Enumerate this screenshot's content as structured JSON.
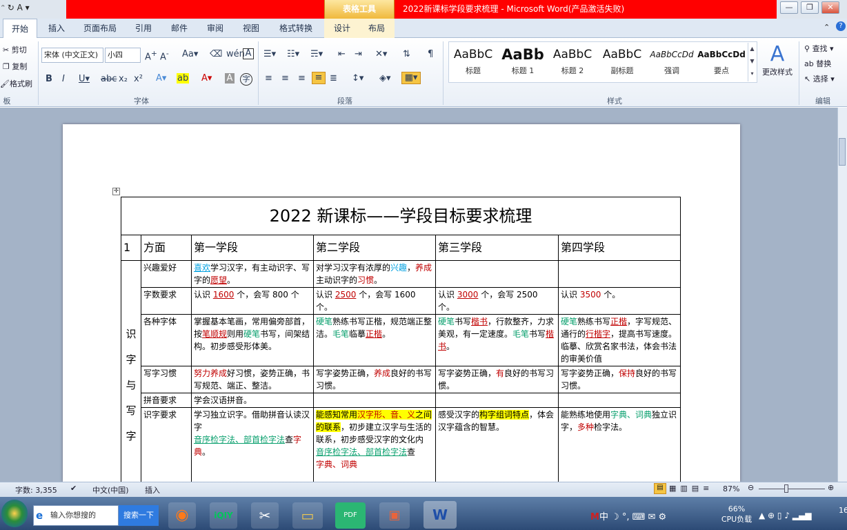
{
  "window": {
    "quick_access": "ᵔ ↻ A ▾",
    "table_tools": "表格工具",
    "title": "2022新课标学段要求梳理 - Microsoft Word(产品激活失败)",
    "min": "—",
    "max": "❐",
    "close": "✕"
  },
  "tabs": [
    "开始",
    "插入",
    "页面布局",
    "引用",
    "邮件",
    "审阅",
    "视图",
    "格式转换",
    "设计",
    "布局"
  ],
  "ribbon": {
    "clipboard": {
      "cut": "剪切",
      "copy": "复制",
      "painter": "格式刷",
      "label": "板"
    },
    "font": {
      "name": "宋体 (中文正文)",
      "size": "小四",
      "label": "字体"
    },
    "paragraph": {
      "label": "段落"
    },
    "styles": {
      "label": "样式",
      "items": [
        {
          "sample": "AaBbC",
          "name": "标题"
        },
        {
          "sample": "AaBb",
          "name": "标题 1"
        },
        {
          "sample": "AaBbC",
          "name": "标题 2"
        },
        {
          "sample": "AaBbC",
          "name": "副标题"
        },
        {
          "sample": "AaBbCcDd",
          "name": "强调"
        },
        {
          "sample": "AaBbCcDd",
          "name": "要点"
        }
      ],
      "change": "更改样式"
    },
    "editing": {
      "find": "查找",
      "replace": "替换",
      "select": "选择",
      "label": "编辑"
    }
  },
  "table": {
    "title": "2022 新课标——学段目标要求梳理",
    "headers": [
      "1",
      "方面",
      "第一学段",
      "第二学段",
      "第三学段",
      "第四学段"
    ],
    "side_label": "识字与写字",
    "rows": {
      "r1": {
        "aspect": "兴趣爱好",
        "s1a": "喜欢",
        "s1b": "学习汉字，有主动识字、写字的",
        "s1c": "愿望",
        "s1d": "。",
        "s2a": "对学习汉字有浓厚的",
        "s2b": "兴趣",
        "s2c": "，",
        "s2d": "养成",
        "s2e": "主动识字的",
        "s2f": "习惯",
        "s2g": "。"
      },
      "r2": {
        "aspect": "字数要求",
        "s1a": "认识 ",
        "s1b": "1600",
        "s1c": " 个，会写 800 个",
        "s2a": "认识 ",
        "s2b": "2500",
        "s2c": " 个，会写 1600 个。",
        "s3a": "认识 ",
        "s3b": "3000",
        "s3c": " 个，会写 2500 个。",
        "s4a": "认识 ",
        "s4b": "3500",
        "s4c": " 个。"
      },
      "r3": {
        "aspect": "各种字体",
        "s1a": "掌握基本笔画，常用偏旁部首，按",
        "s1b": "笔顺规",
        "s1c": "则用",
        "s1d": "硬笔",
        "s1e": "书写，间架结构。初步感受形体美。",
        "s2a": "硬笔",
        "s2b": "熟练书写正楷，规范端正整洁。",
        "s2c": "毛笔",
        "s2d": "临摹",
        "s2e": "正楷",
        "s2f": "。",
        "s3a": "硬笔",
        "s3b": "书写",
        "s3c": "楷书",
        "s3d": "，行款整齐，力求美观，有一定速度。",
        "s3e": "毛笔",
        "s3f": "书写",
        "s3g": "楷书",
        "s3h": "。",
        "s4a": "硬笔",
        "s4b": "熟练书写",
        "s4c": "正楷",
        "s4d": "，字写规范、通行的",
        "s4e": "行楷字",
        "s4f": "，提高书写速度。临摹、欣赏名家书法，体会书法的审美价值"
      },
      "r4": {
        "aspect": "写字习惯",
        "s1a": "努力养成",
        "s1b": "好习惯，姿势正确，书写规范、端正、整洁。",
        "s2a": "写字姿势正确，",
        "s2b": "养成",
        "s2c": "良好的书写习惯。",
        "s3a": "写字姿势正确，",
        "s3b": "有",
        "s3c": "良好的书写习惯。",
        "s4a": "写字姿势正确，",
        "s4b": "保持",
        "s4c": "良好的书写习惯。"
      },
      "r5": {
        "aspect": "拼音要求",
        "s1": "学会汉语拼音。"
      },
      "r6": {
        "aspect": "识字要求",
        "s1a": "学习独立识字。借助拼音认读汉字",
        "s1b": "音序检字法、部首检字法",
        "s1c": "查",
        "s1d": "字典",
        "s1e": "。",
        "s2a": "能感知常用",
        "s2b": "汉字形、音、义",
        "s2c": "之间的联系",
        "s2d": "，初步建立汉字与生活的联系，初步感受汉字的文化内",
        "s2e": "音序检字法、部首检字法",
        "s2f": "查",
        "s2g": "字典、词典",
        "s3a": "感受汉字的",
        "s3b": "构字组词特点",
        "s3c": "，体会汉字蕴含的智慧。",
        "s4a": "能熟练地使用",
        "s4b": "字典、词典",
        "s4c": "独立识字，",
        "s4d": "多种",
        "s4e": "检字法。"
      }
    }
  },
  "status": {
    "words": "字数: 3,355",
    "lang": "中文(中国)",
    "mode": "插入",
    "zoom": "87%"
  },
  "taskbar": {
    "search_placeholder": "输入你想搜的",
    "search_btn": "搜索一下",
    "cpu": "66%",
    "cpu_label": "CPU负载",
    "time": "16",
    "ime": "中"
  }
}
